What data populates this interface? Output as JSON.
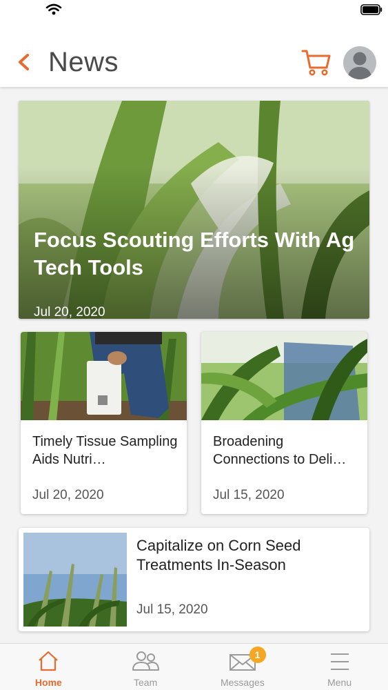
{
  "header": {
    "title": "News"
  },
  "colors": {
    "accent": "#E86A2C",
    "badge": "#F5A623",
    "tab_inactive": "#9A9A9A"
  },
  "icons": {
    "back": "chevron-left-icon",
    "cart": "cart-icon",
    "avatar": "user-avatar-icon",
    "wifi": "wifi-icon",
    "battery": "battery-icon"
  },
  "featured": {
    "title": "Focus Scouting Efforts With Ag Tech Tools",
    "date": "Jul 20, 2020"
  },
  "articles": [
    {
      "title": "Timely Tissue Sampling Aids Nutri…",
      "date": "Jul 20, 2020"
    },
    {
      "title": "Broadening Connections to Deli…",
      "date": "Jul 15, 2020"
    },
    {
      "title": "Capitalize on Corn Seed Treatments In-Season",
      "date": "Jul 15, 2020"
    }
  ],
  "tabbar": {
    "tabs": [
      {
        "label": "Home",
        "icon": "home-icon",
        "active": true
      },
      {
        "label": "Team",
        "icon": "team-icon",
        "active": false
      },
      {
        "label": "Messages",
        "icon": "mail-icon",
        "active": false,
        "badge": "1"
      },
      {
        "label": "Menu",
        "icon": "menu-icon",
        "active": false
      }
    ]
  }
}
